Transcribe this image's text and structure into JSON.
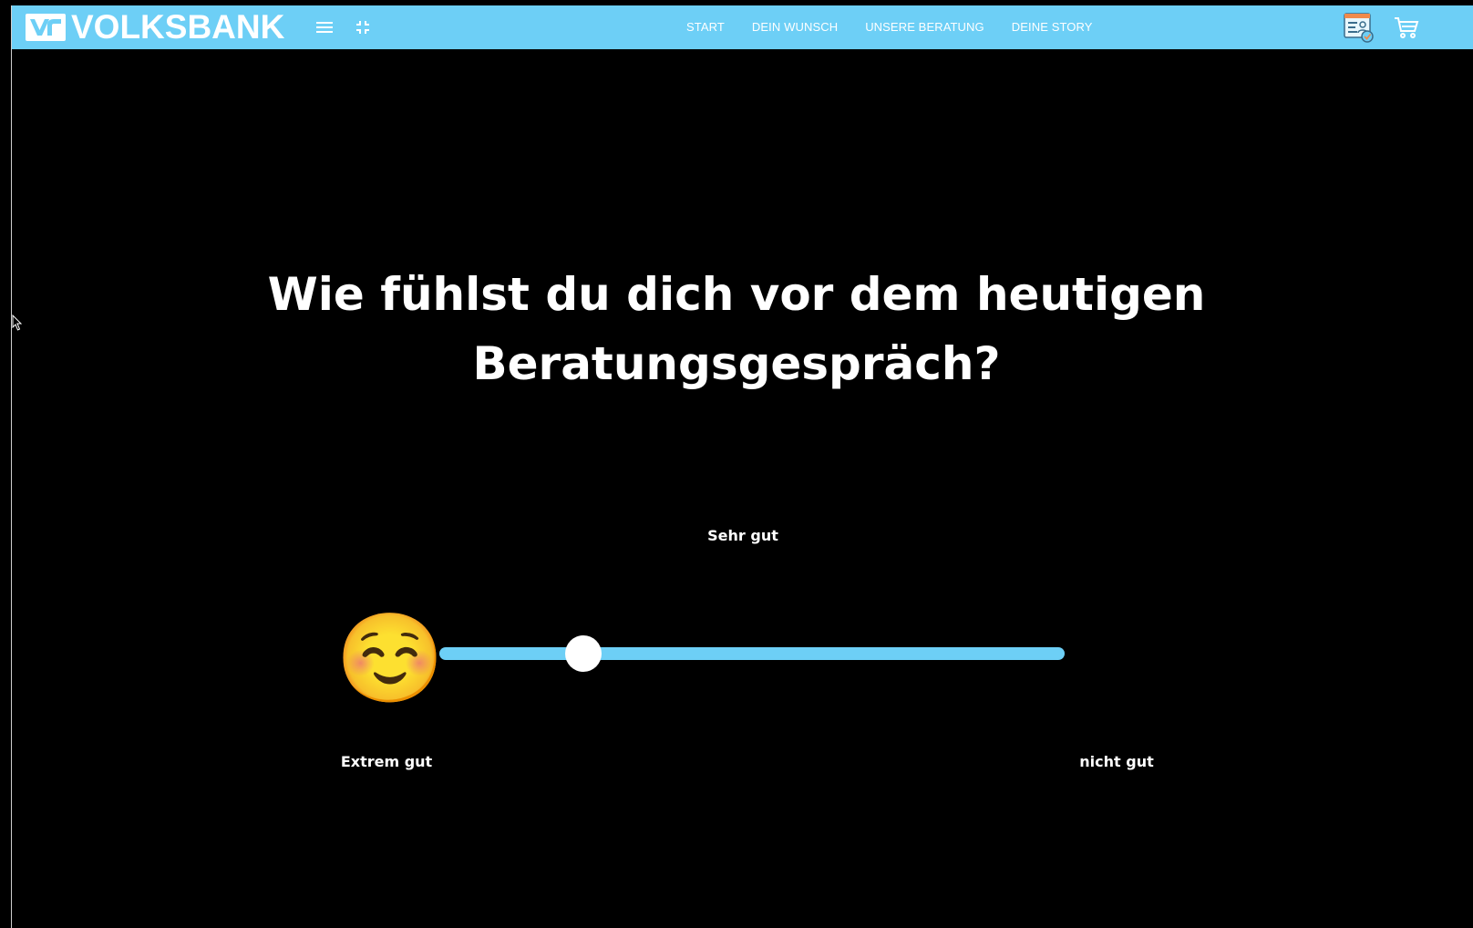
{
  "brand": {
    "name": "VOLKSBANK",
    "color": "#6dcff6"
  },
  "toolbar": {
    "menu_icon": "hamburger-menu-icon",
    "collapse_icon": "fullscreen-exit-icon",
    "consultation_icon": "consultation-check-icon",
    "cart_icon": "shopping-cart-icon"
  },
  "nav": {
    "items": [
      {
        "label": "START"
      },
      {
        "label": "DEIN WUNSCH"
      },
      {
        "label": "UNSERE BERATUNG"
      },
      {
        "label": "DEINE STORY"
      }
    ]
  },
  "survey": {
    "question_line1": "Wie fühlst du dich vor dem heutigen",
    "question_line2": "Beratungsgespräch?",
    "current": {
      "emoji": "😄",
      "label": "Sehr gut"
    },
    "left": {
      "emoji": "☺️",
      "label": "Extrem gut"
    },
    "right": {
      "emoji": "😕",
      "label": "nicht gut"
    },
    "slider_value": 0.23
  },
  "colors": {
    "background": "#000000",
    "accent": "#6dcff6",
    "text": "#ffffff"
  }
}
